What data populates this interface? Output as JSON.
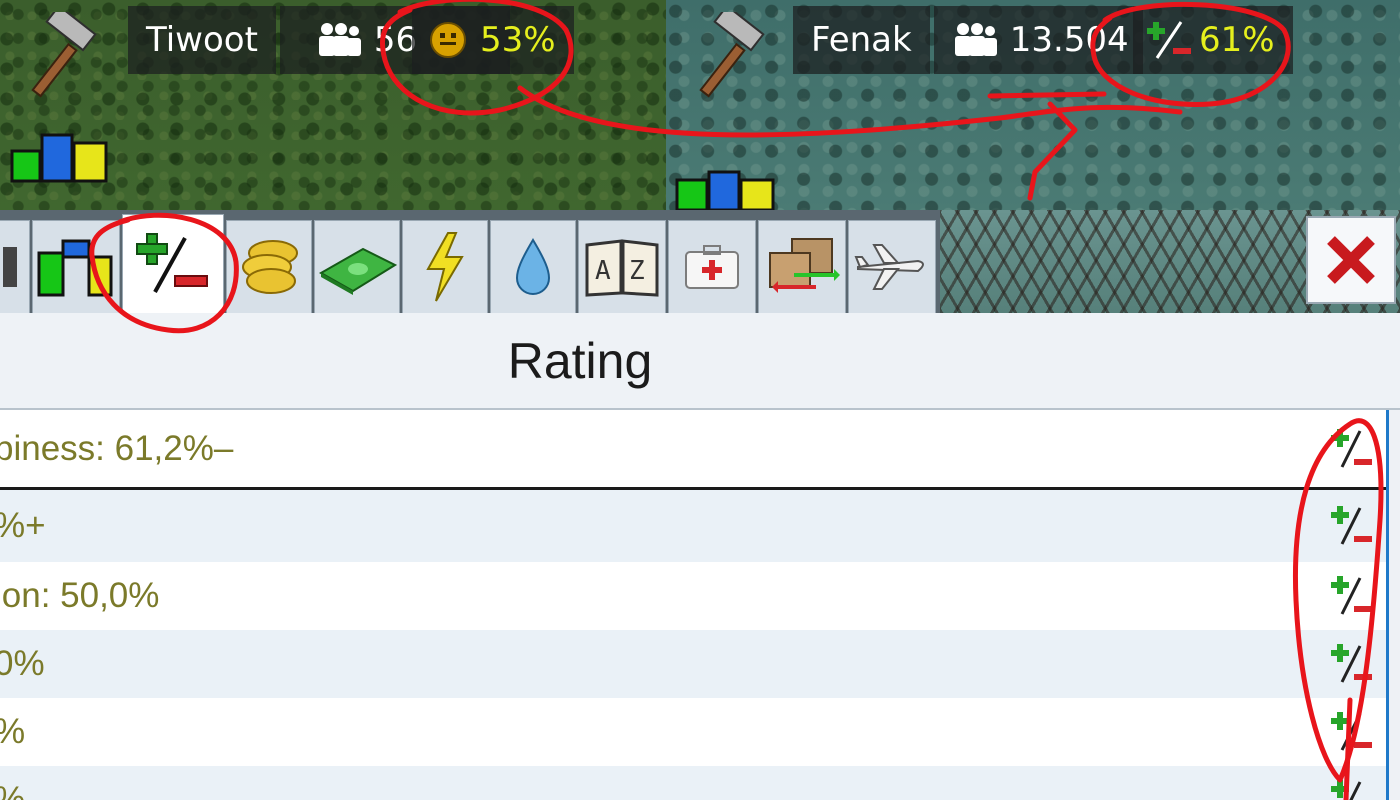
{
  "cities": [
    {
      "name": "Tiwoot",
      "population": "56",
      "rating_value": "53%",
      "rating_icon": "smiley-icon",
      "bar_colors": [
        "#16c616",
        "#2068dd",
        "#e7e51a"
      ]
    },
    {
      "name": "Fenak",
      "population": "13.504",
      "rating_value": "61%",
      "rating_icon": "plus-minus-icon",
      "bar_colors": [
        "#16c616",
        "#2068dd",
        "#e7e51a"
      ]
    }
  ],
  "tabs": [
    {
      "icon": "partial-tab-icon"
    },
    {
      "icon": "city-bars-icon"
    },
    {
      "icon": "rating-plus-minus-icon",
      "active": true
    },
    {
      "icon": "gold-coins-icon"
    },
    {
      "icon": "cash-icon"
    },
    {
      "icon": "lightning-icon"
    },
    {
      "icon": "water-drop-icon"
    },
    {
      "icon": "dictionary-az-icon"
    },
    {
      "icon": "medical-kit-icon"
    },
    {
      "icon": "transfer-boxes-icon"
    },
    {
      "icon": "airplane-icon"
    }
  ],
  "close_icon": "close-x-icon",
  "window": {
    "title": "Rating",
    "rows": [
      {
        "text": "piness: 61,2%–",
        "icon": "plus-minus-icon"
      },
      {
        "text": "%+",
        "icon": "plus-minus-icon"
      },
      {
        "text": "ion: 50,0%",
        "icon": "plus-minus-icon"
      },
      {
        "text": "0%",
        "icon": "plus-minus-icon"
      },
      {
        "text": "%",
        "icon": "plus-minus-icon"
      },
      {
        "text": "%",
        "icon": "plus-minus-icon"
      }
    ]
  },
  "colors": {
    "annotation": "#e8151b",
    "rating_text": "#7b7a2a",
    "highlight_yellow": "#e5ef1d"
  }
}
